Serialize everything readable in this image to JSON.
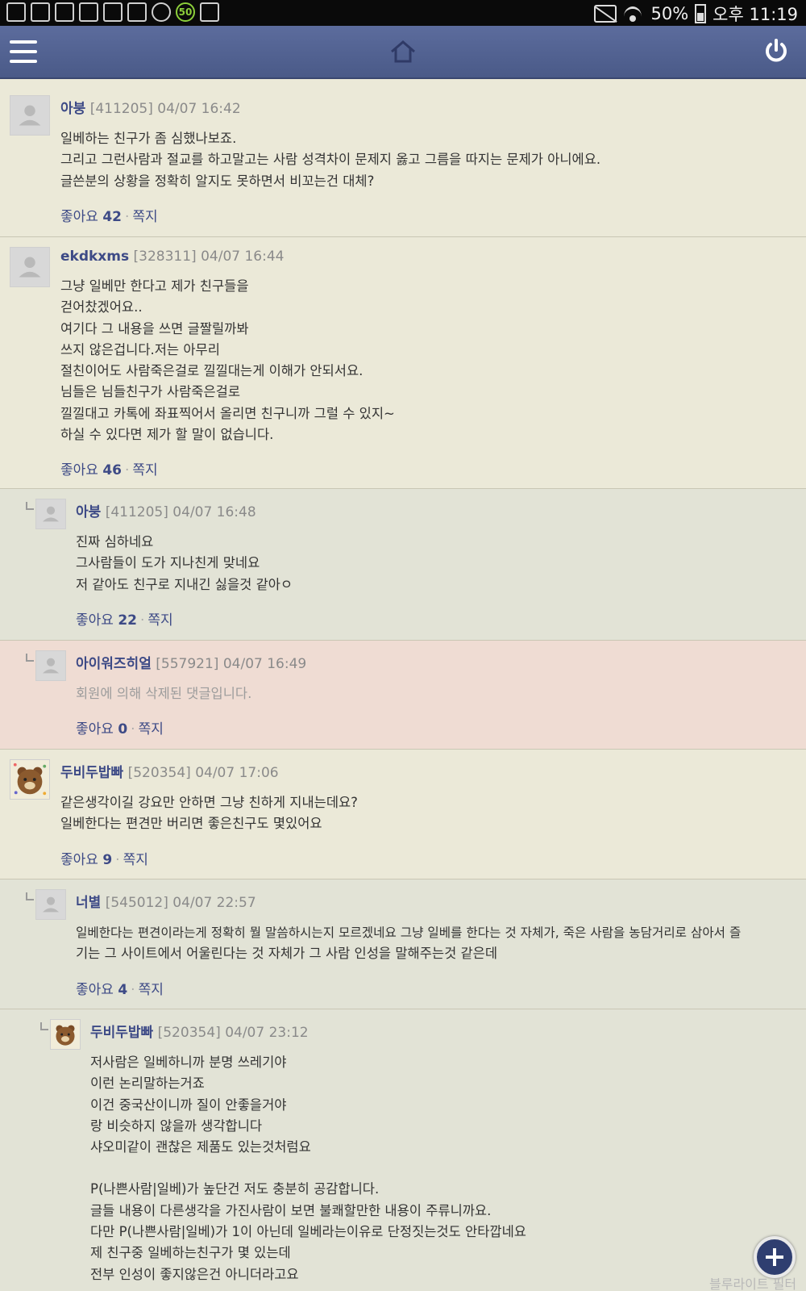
{
  "status_bar": {
    "battery": "50%",
    "time": "오후 11:19",
    "badge": "50"
  },
  "app_bar": {
    "icons": [
      "menu-icon",
      "home-icon",
      "power-icon"
    ]
  },
  "labels": {
    "like": "좋아요",
    "message": "쪽지"
  },
  "comments": [
    {
      "name": "아붕",
      "id": "[411205]",
      "date": "04/07 16:42",
      "lines": [
        "일베하는 친구가 좀 심했나보죠.",
        "그리고 그런사람과 절교를 하고말고는 사람 성격차이 문제지 옳고 그름을 따지는 문제가 아니에요.",
        "글쓴분의 상황을 정확히 알지도 못하면서 비꼬는건 대체?"
      ],
      "likes": "42"
    },
    {
      "name": "ekdkxms",
      "id": "[328311]",
      "date": "04/07 16:44",
      "lines": [
        "그냥 일베만 한다고 제가 친구들을",
        "걷어찼겠어요..",
        "여기다 그 내용을 쓰면 글짤릴까봐",
        "쓰지 않은겁니다.저는 아무리",
        "절친이어도 사람죽은걸로 낄낄대는게 이해가 안되서요.",
        "님들은 님들친구가 사람죽은걸로",
        "낄낄대고 카톡에 좌표찍어서 올리면 친구니까 그럴 수 있지~",
        "하실 수 있다면 제가 할 말이 없습니다."
      ],
      "likes": "46"
    },
    {
      "name": "아붕",
      "id": "[411205]",
      "date": "04/07 16:48",
      "lines": [
        "진짜 심하네요",
        "그사람들이 도가 지나친게 맞네요",
        "저 같아도 친구로 지내긴 싫을것 같아ㅇ"
      ],
      "likes": "22"
    },
    {
      "name": "아이워즈히얼",
      "id": "[557921]",
      "date": "04/07 16:49",
      "lines": [
        "회원에 의해 삭제된 댓글입니다."
      ],
      "likes": "0"
    },
    {
      "name": "두비두밥빠",
      "id": "[520354]",
      "date": "04/07 17:06",
      "lines": [
        "같은생각이길 강요만 안하면 그냥 친하게 지내는데요?",
        "일베한다는 편견만 버리면 좋은친구도 몇있어요"
      ],
      "likes": "9"
    },
    {
      "name": "너별",
      "id": "[545012]",
      "date": "04/07 22:57",
      "lines": [
        "일베한다는 편견이라는게 정확히 뭘 말씀하시는지 모르겠네요 그냥 일베를 한다는 것 자체가, 죽은 사람을 농담거리로 삼아서 즐",
        "기는 그 사이트에서 어울린다는 것 자체가 그 사람 인성을 말해주는것 같은데"
      ],
      "likes": "4"
    },
    {
      "name": "두비두밥빠",
      "id": "[520354]",
      "date": "04/07 23:12",
      "lines": [
        "저사람은 일베하니까 분명 쓰레기야",
        "이런 논리말하는거죠",
        "이건 중국산이니까 질이 안좋을거야",
        "랑 비슷하지 않을까 생각합니다",
        "샤오미같이 괜찮은 제품도 있는것처럼요",
        "",
        "P(나쁜사람|일베)가 높단건 저도 충분히 공감합니다.",
        "글들 내용이 다른생각을 가진사람이 보면 불쾌할만한 내용이 주류니까요.",
        "다만 P(나쁜사람|일베)가 1이 아닌데 일베라는이유로 단정짓는것도 안타깝네요",
        "제 친구중 일베하는친구가 몇 있는데",
        "전부 인성이 좋지않은건 아니더라고요"
      ],
      "likes": ""
    }
  ],
  "fab": {
    "icon": "plus-icon"
  },
  "watermark": "블루라이트 필터"
}
